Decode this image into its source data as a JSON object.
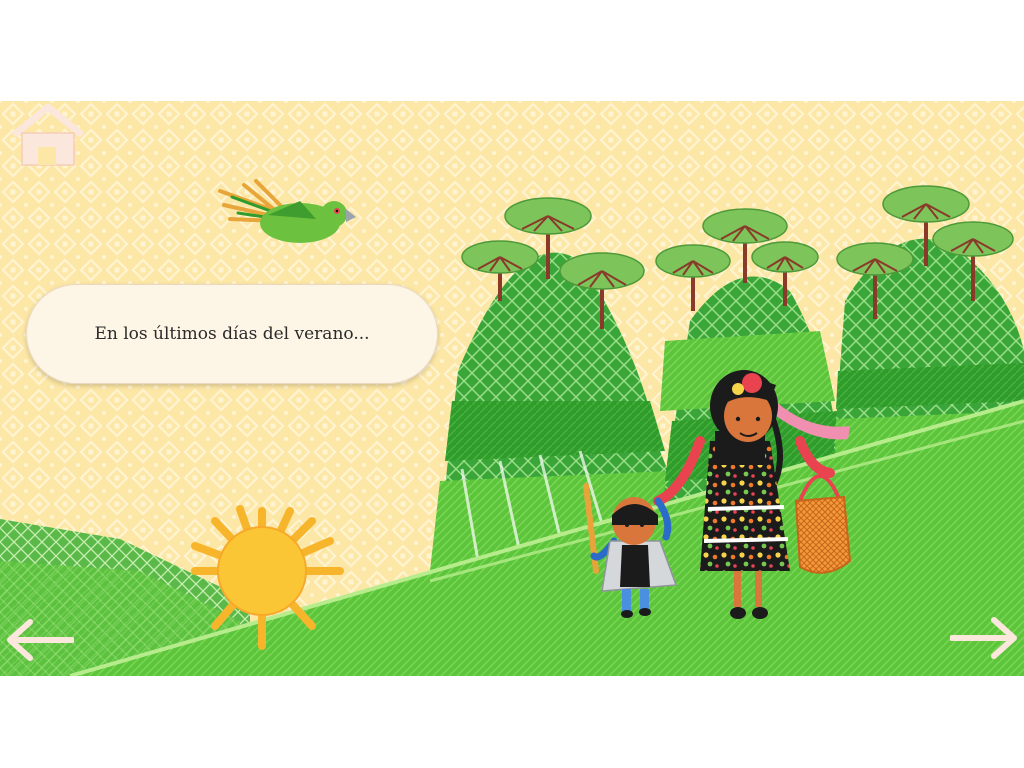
{
  "story": {
    "narration": "En los últimos días del verano..."
  },
  "navigation": {
    "home_icon": "home-icon",
    "prev_icon": "arrow-left-icon",
    "next_icon": "arrow-right-icon"
  },
  "palette": {
    "background": "#fde7a6",
    "pattern": "#fff4d2",
    "grass": "#5bc63a",
    "hill_dark": "#2f9c2c",
    "tree_top": "#7dc45a",
    "sun": "#fbc635",
    "bubble": "#fdf5e6"
  }
}
